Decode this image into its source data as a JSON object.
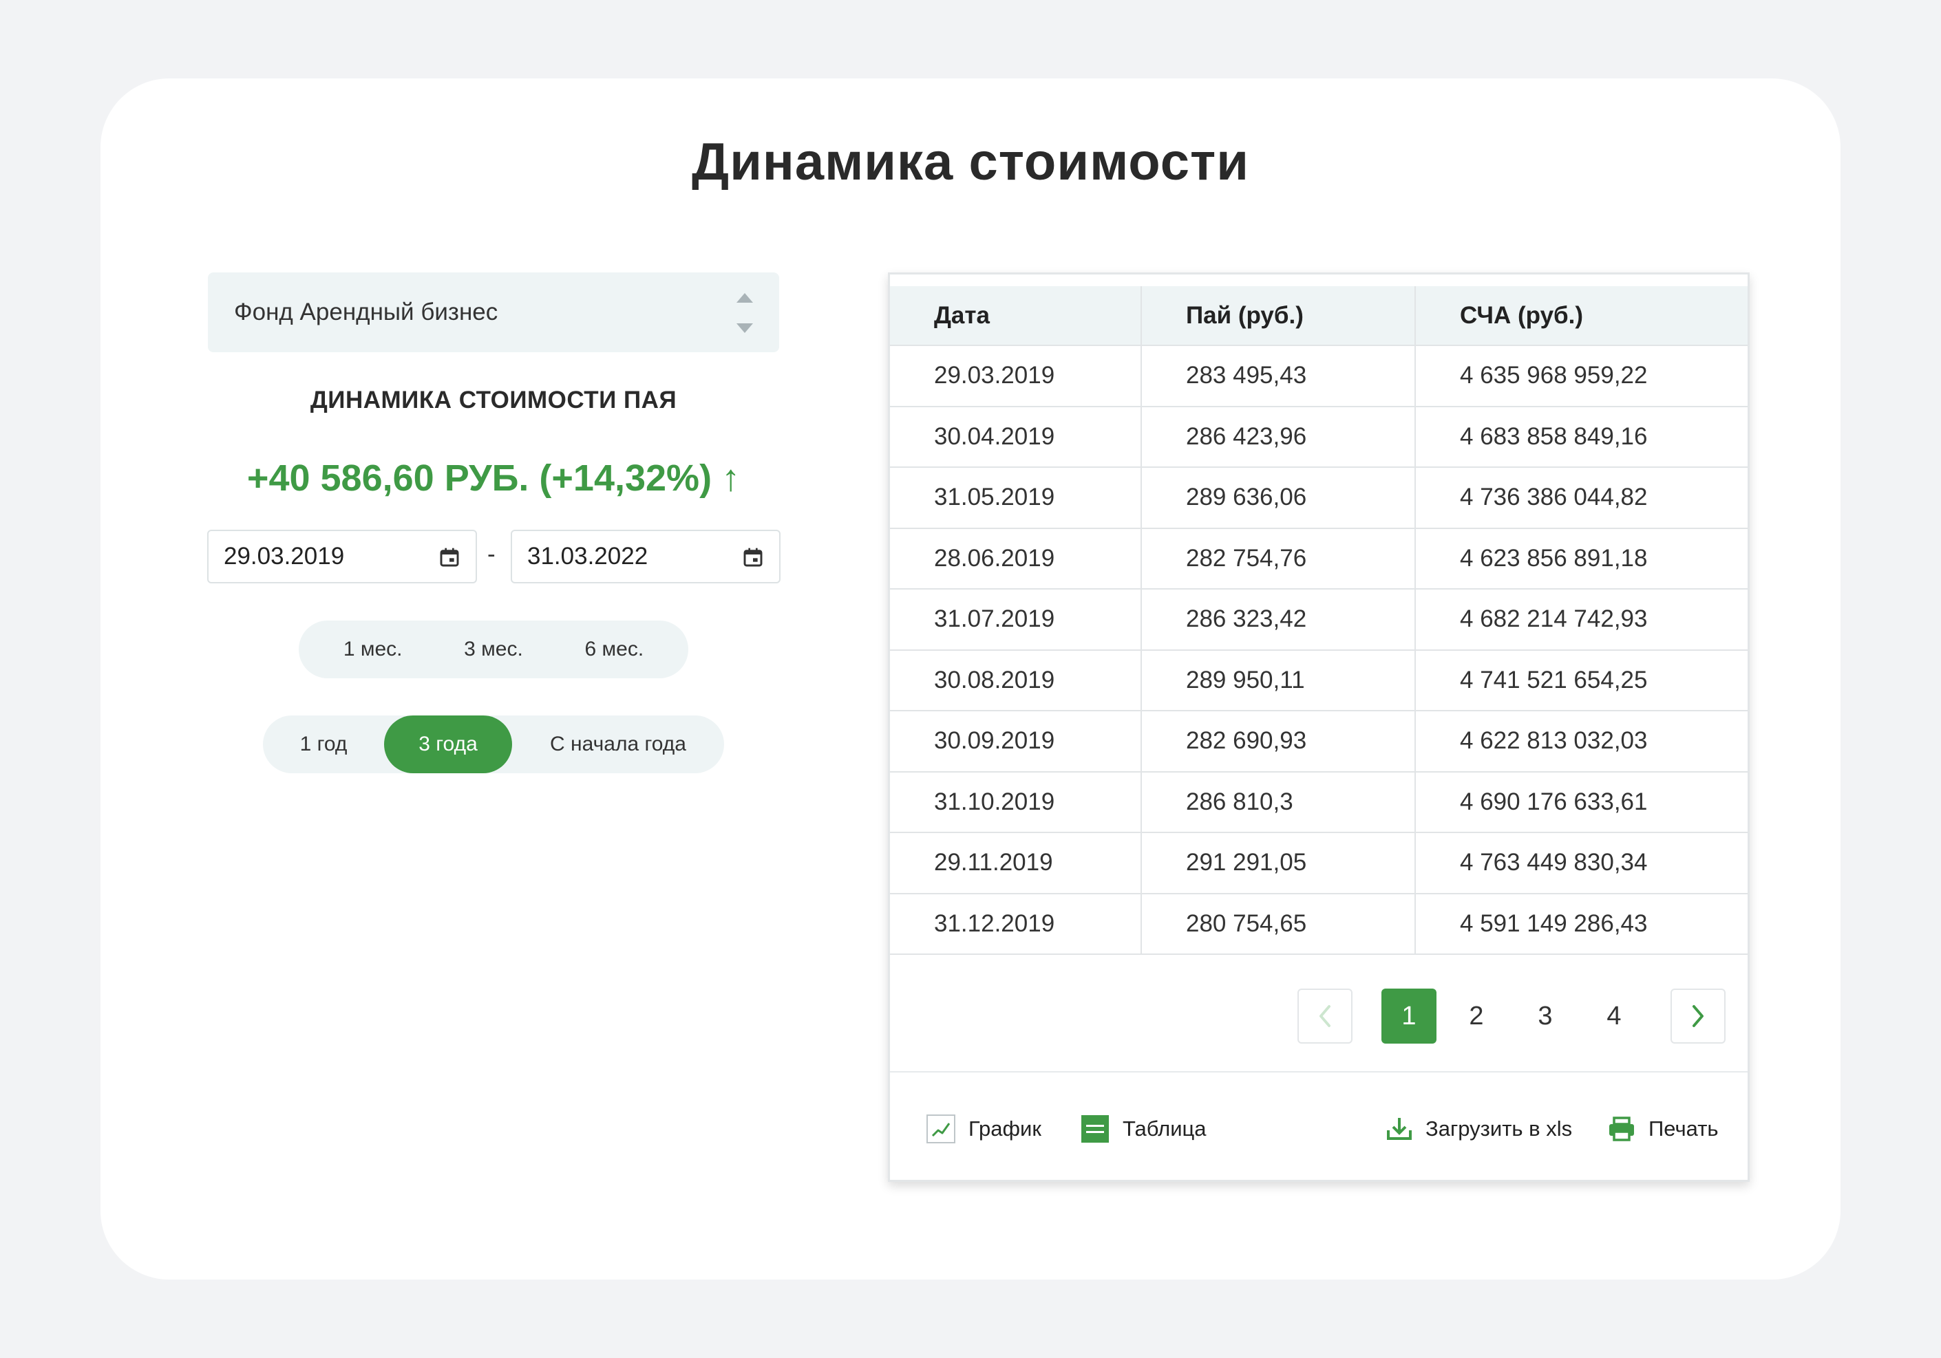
{
  "title": "Динамика стоимости",
  "fund_select": {
    "value": "Фонд Арендный бизнес"
  },
  "subtitle": "ДИНАМИКА СТОИМОСТИ ПАЯ",
  "change": {
    "value": "+40 586,60 РУБ. (+14,32%)",
    "arrow": "↑"
  },
  "date_range": {
    "from": "29.03.2019",
    "to": "31.03.2022",
    "separator": "-"
  },
  "periods": {
    "m1": "1 мес.",
    "m3": "3 мес.",
    "m6": "6 мес.",
    "y1": "1 год",
    "y3": "3 года",
    "ytd": "С начала года",
    "active": "3 года"
  },
  "table": {
    "headers": [
      "Дата",
      "Пай (руб.)",
      "СЧА (руб.)"
    ],
    "rows": [
      [
        "29.03.2019",
        "283 495,43",
        "4 635 968 959,22"
      ],
      [
        "30.04.2019",
        "286 423,96",
        "4 683 858 849,16"
      ],
      [
        "31.05.2019",
        "289 636,06",
        "4 736 386 044,82"
      ],
      [
        "28.06.2019",
        "282 754,76",
        "4 623 856 891,18"
      ],
      [
        "31.07.2019",
        "286 323,42",
        "4 682 214 742,93"
      ],
      [
        "30.08.2019",
        "289 950,11",
        "4 741 521 654,25"
      ],
      [
        "30.09.2019",
        "282 690,93",
        "4 622 813 032,03"
      ],
      [
        "31.10.2019",
        "286 810,3",
        "4 690 176 633,61"
      ],
      [
        "29.11.2019",
        "291 291,05",
        "4 763 449 830,34"
      ],
      [
        "31.12.2019",
        "280 754,65",
        "4 591 149 286,43"
      ]
    ]
  },
  "pagination": {
    "pages": [
      "1",
      "2",
      "3",
      "4"
    ],
    "current": "1"
  },
  "footer": {
    "chart": "График",
    "table": "Таблица",
    "xls": "Загрузить в xls",
    "print": "Печать"
  },
  "colors": {
    "accent": "#3f9a45",
    "panel_bg": "#eef4f5",
    "page_bg": "#f2f3f5"
  }
}
